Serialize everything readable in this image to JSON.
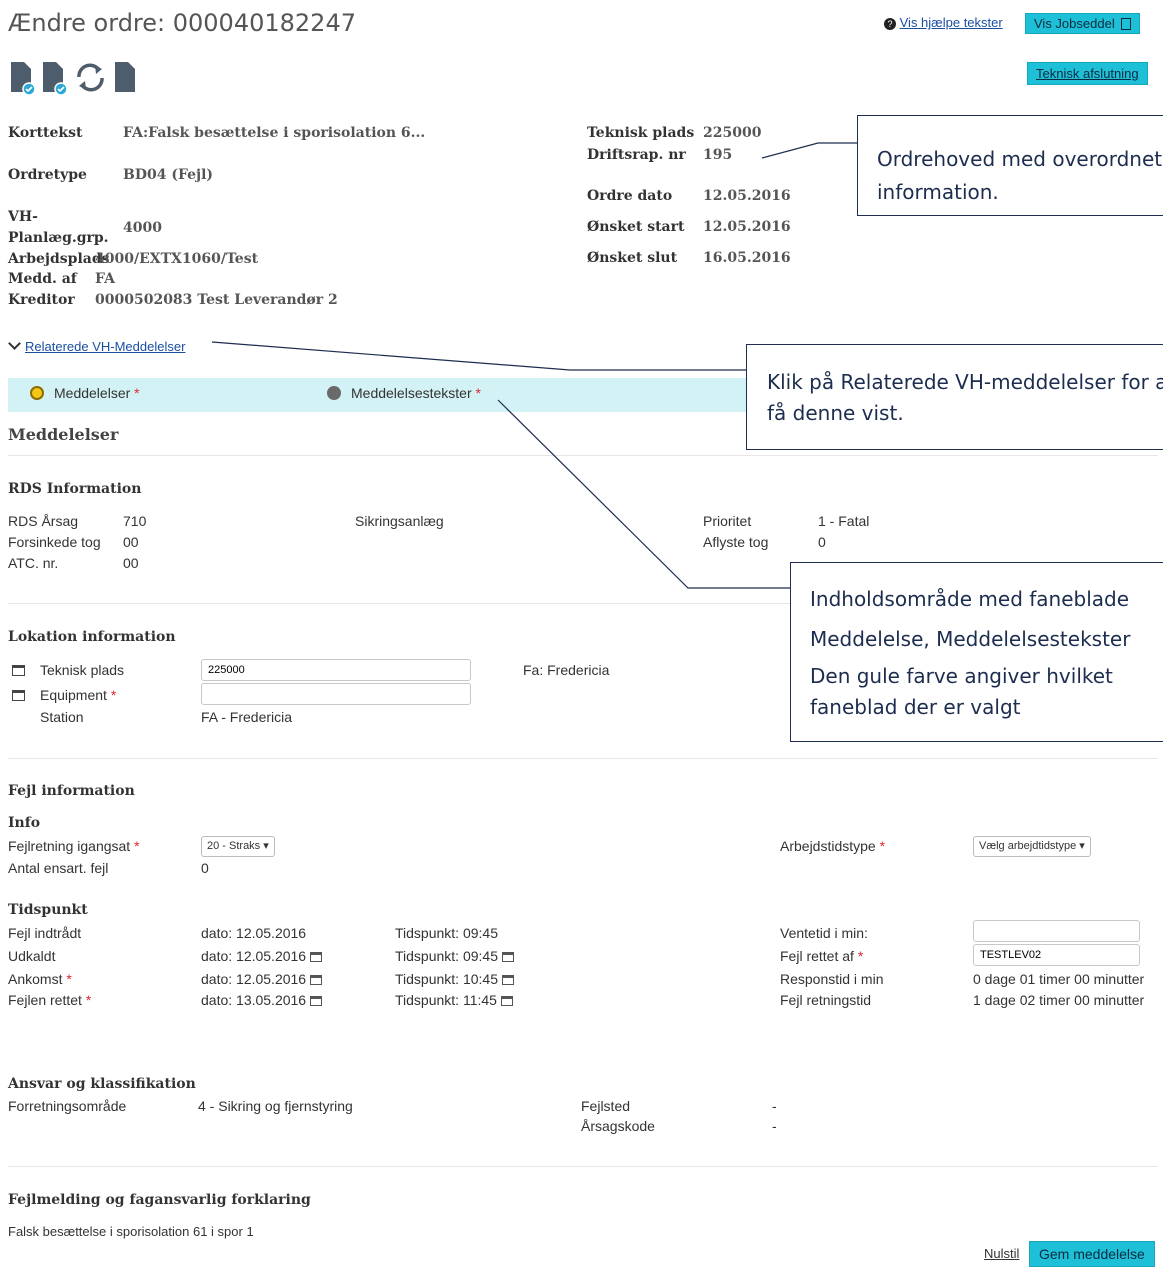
{
  "header": {
    "title": "Ændre ordre: 000040182247",
    "help_link": "Vis hjælpe tekster",
    "jobsheet_button": "Vis Jobseddel",
    "tech_close_button": "Teknisk afslutning"
  },
  "order": {
    "left": [
      {
        "label": "Korttekst",
        "value": "FA:Falsk besættelse i sporisolation 6..."
      },
      {
        "label": "Ordretype",
        "value": "BD04 (Fejl)"
      },
      {
        "label": "VH-",
        "label2": "Planlæg.grp.",
        "value": "4000"
      },
      {
        "label": "Arbejdsplads",
        "value": "4000/EXTX1060/Test"
      },
      {
        "label": "Medd. af",
        "value": "FA"
      },
      {
        "label": "Kreditor",
        "value": "0000502083 Test Leverandør 2"
      }
    ],
    "right": [
      {
        "label": "Teknisk plads",
        "value": "225000"
      },
      {
        "label": "Driftsrap. nr",
        "value": "195"
      },
      {
        "label": "Ordre dato",
        "value": "12.05.2016"
      },
      {
        "label": "Ønsket start",
        "value": "12.05.2016"
      },
      {
        "label": "Ønsket slut",
        "value": "16.05.2016"
      }
    ]
  },
  "related_link": "Relaterede VH-Meddelelser",
  "tabs": [
    {
      "label": "Meddelelser",
      "selected": true
    },
    {
      "label": "Meddelelsestekster",
      "selected": false
    }
  ],
  "section_title": "Meddelelser",
  "rds": {
    "title": "RDS Information",
    "rows": [
      {
        "label": "RDS Årsag",
        "value": "710"
      },
      {
        "label": "Forsinkede tog",
        "value": "00"
      },
      {
        "label": "ATC. nr.",
        "value": "00"
      }
    ],
    "middle": "Sikringsanlæg",
    "right": [
      {
        "label": "Prioritet",
        "value": "1 - Fatal"
      },
      {
        "label": "Aflyste tog",
        "value": "0"
      }
    ]
  },
  "location": {
    "title": "Lokation information",
    "tech_label": "Teknisk plads",
    "tech_value": "225000",
    "tech_desc": "Fa: Fredericia",
    "equip_label": "Equipment",
    "equip_value": "",
    "station_label": "Station",
    "station_value": "FA - Fredericia"
  },
  "fault": {
    "title": "Fejl information",
    "info_title": "Info",
    "direction_label": "Fejlretning igangsat",
    "direction_value": "20 - Straks",
    "count_label": "Antal ensart. fejl",
    "count_value": "0",
    "worktime_label": "Arbejdstidstype",
    "worktime_value": "Vælg arbejdtidstype",
    "time_title": "Tidspunkt",
    "times": [
      {
        "label": "Fejl indtrådt",
        "req": false,
        "date": "dato: 12.05.2016",
        "time": "Tidspunkt: 09:45",
        "cal": false
      },
      {
        "label": "Udkaldt",
        "req": false,
        "date": "dato: 12.05.2016",
        "time": "Tidspunkt: 09:45",
        "cal": true
      },
      {
        "label": "Ankomst",
        "req": true,
        "date": "dato: 12.05.2016",
        "time": "Tidspunkt: 10:45",
        "cal": true
      },
      {
        "label": "Fejlen rettet",
        "req": true,
        "date": "dato: 13.05.2016",
        "time": "Tidspunkt: 11:45",
        "cal": true
      }
    ],
    "wait_label": "Ventetid i min:",
    "wait_value": "",
    "fixedby_label": "Fejl rettet af",
    "fixedby_value": "TESTLEV02",
    "response_label": "Responstid i min",
    "response_value": "0 dage 01 timer 00 minutter",
    "dirtime_label": "Fejl retningstid",
    "dirtime_value": "1 dage 02 timer 00 minutter"
  },
  "responsibility": {
    "title": "Ansvar og klassifikation",
    "area_label": "Forretningsområde",
    "area_value": "4 - Sikring og fjernstyring",
    "place_label": "Fejlsted",
    "place_value": "-",
    "cause_label": "Årsagskode",
    "cause_value": "-"
  },
  "report": {
    "title": "Fejlmelding og fagansvarlig forklaring",
    "text": "Falsk besættelse i sporisolation 61 i spor 1"
  },
  "footer": {
    "reset_link": "Nulstil",
    "save_button": "Gem meddelelse"
  },
  "callouts": {
    "c1": "Ordrehoved med overordnet information.",
    "c2": "Klik på Relaterede VH-meddelelser for at få denne vist.",
    "c3_line1": "Indholdsområde med faneblade",
    "c3_line2": "Meddelelse, Meddelelsestekster",
    "c3_line3": "Den gule farve angiver hvilket faneblad der er valgt"
  },
  "colors": {
    "accent": "#1ec0d8",
    "tab_bar": "#d3f2f5",
    "selected_dot": "#f5c518",
    "callout_text": "#1c2d4f",
    "required": "#e0262e"
  }
}
